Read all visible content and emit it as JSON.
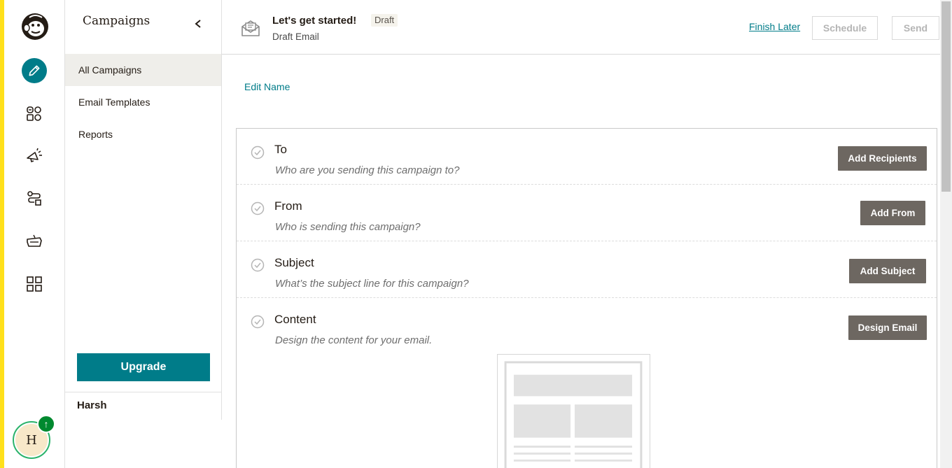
{
  "rail": {
    "stripe_color": "#ffe01b",
    "active_color": "#007c89",
    "icons": [
      "freddie-logo-icon",
      "pencil-icon",
      "audience-icon",
      "campaigns-megaphone-icon",
      "automations-icon",
      "website-icon",
      "integrations-grid-icon"
    ],
    "avatar": {
      "initial": "H",
      "badge": "↑"
    }
  },
  "sidebar": {
    "title": "Campaigns",
    "items": [
      {
        "label": "All Campaigns",
        "active": true
      },
      {
        "label": "Email Templates",
        "active": false
      },
      {
        "label": "Reports",
        "active": false
      }
    ],
    "upgrade_label": "Upgrade",
    "user_name": "Harsh"
  },
  "header": {
    "title": "Let's get started!",
    "badge": "Draft",
    "subtitle": "Draft Email",
    "finish_later": "Finish Later",
    "schedule": "Schedule",
    "send": "Send"
  },
  "main": {
    "edit_name": "Edit Name",
    "rows": [
      {
        "title": "To",
        "description": "Who are you sending this campaign to?",
        "action": "Add Recipients"
      },
      {
        "title": "From",
        "description": "Who is sending this campaign?",
        "action": "Add From"
      },
      {
        "title": "Subject",
        "description": "What’s the subject line for this campaign?",
        "action": "Add Subject"
      },
      {
        "title": "Content",
        "description": "Design the content for your email.",
        "action": "Design Email"
      }
    ]
  },
  "colors": {
    "accent": "#007c89",
    "button_dark": "#6d6761",
    "upgrade": "#007c89"
  }
}
